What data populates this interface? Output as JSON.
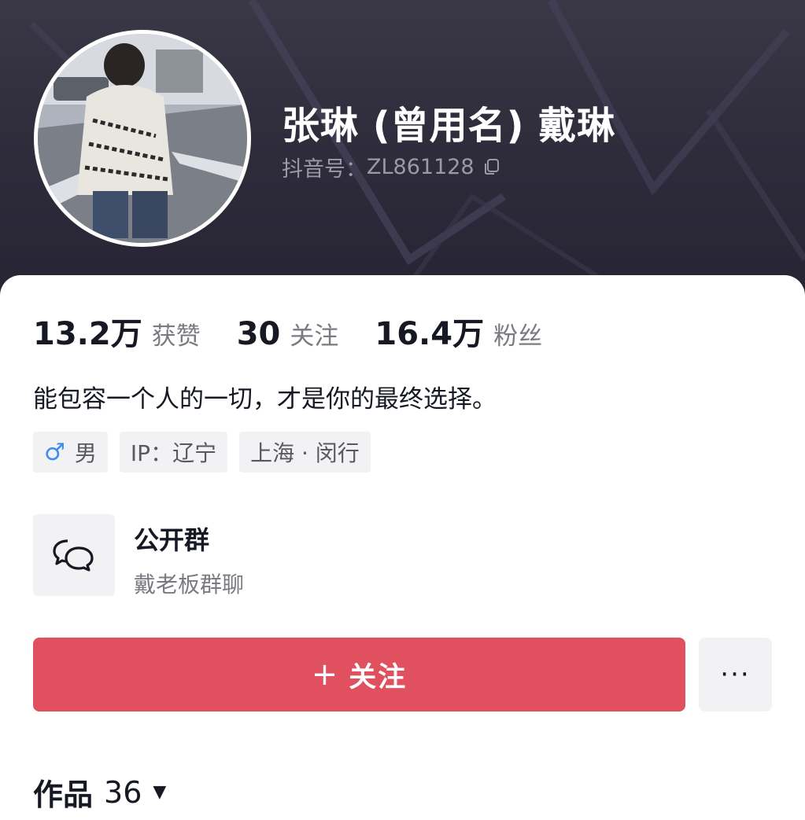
{
  "profile": {
    "display_name": "张琳 (曾用名) 戴琳",
    "handle_label": "抖音号：",
    "handle_value": "ZL861128",
    "bio": "能包容一个人的一切，才是你的最终选择。"
  },
  "stats": [
    {
      "value": "13.2万",
      "label": "获赞"
    },
    {
      "value": "30",
      "label": "关注"
    },
    {
      "value": "16.4万",
      "label": "粉丝"
    }
  ],
  "tags": {
    "gender_icon": "♂",
    "gender": "男",
    "ip": "IP：辽宁",
    "location": "上海 · 闵行"
  },
  "group": {
    "icon": "chat-bubbles-icon",
    "title": "公开群",
    "subtitle": "戴老板群聊"
  },
  "actions": {
    "follow_plus": "+",
    "follow_label": "关注",
    "more_label": "···"
  },
  "works": {
    "label": "作品",
    "count": "36",
    "arrow": "▼"
  },
  "colors": {
    "header_bg": "#2f2d3c",
    "follow_button": "#e0505f",
    "male_icon": "#3c8df2",
    "tag_bg": "#f2f2f4"
  }
}
